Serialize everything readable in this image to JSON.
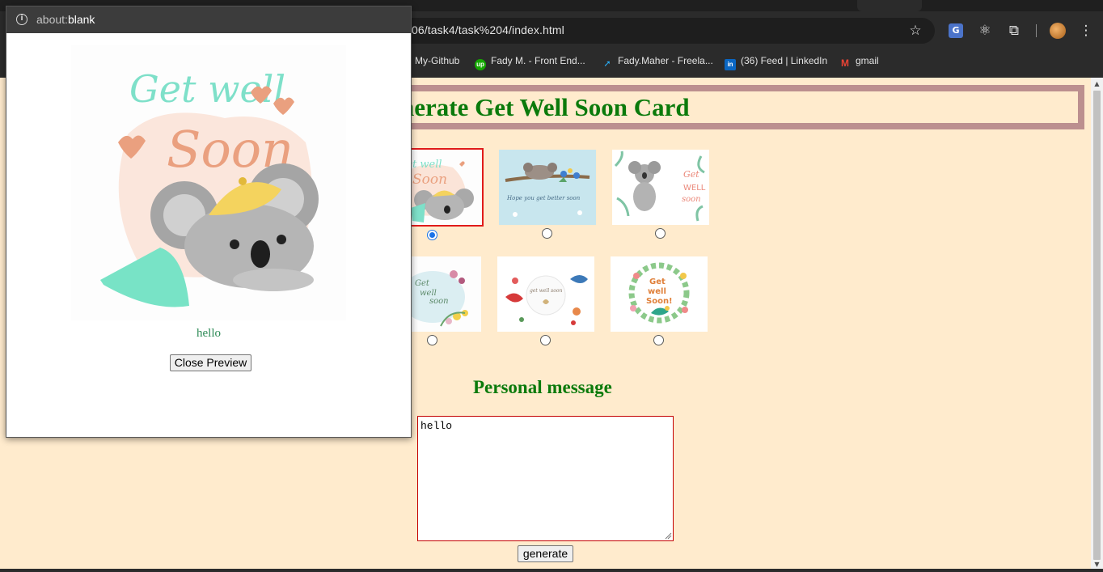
{
  "browser": {
    "url_text": "06/task4/task%204/index.html",
    "bookmarks": [
      {
        "label": "My-Github",
        "icon": "github-icon",
        "color": "#2b2b2b"
      },
      {
        "label": "Fady M. - Front End...",
        "icon": "upwork-icon",
        "color": "#14a800"
      },
      {
        "label": "Fady.Maher - Freela...",
        "icon": "freelancer-icon",
        "color": "#29b2fe"
      },
      {
        "label": "(36) Feed | LinkedIn",
        "icon": "linkedin-icon",
        "color": "#0a66c2"
      },
      {
        "label": "gmail",
        "icon": "gmail-icon",
        "color": "#ea4335"
      }
    ]
  },
  "page": {
    "title": "nerate Get Well Soon Card",
    "background": "#ffebcd",
    "title_color": "#0b7a0b",
    "cards": [
      {
        "name": "get-well-soon-koala-card",
        "selected": true
      },
      {
        "name": "hope-you-get-better-koala-card",
        "selected": false
      },
      {
        "name": "get-well-soon-koala-leaves-card",
        "selected": false
      },
      {
        "name": "get-well-soon-watercolor-flowers-card",
        "selected": false
      },
      {
        "name": "get-well-soon-birds-card",
        "selected": false
      },
      {
        "name": "get-well-soon-bird-wreath-card",
        "selected": false
      }
    ],
    "card_texts": {
      "card1_line1": "Get well",
      "card1_line2": "Soon",
      "card2": "Hope you get better soon",
      "card3_line1": "Get",
      "card3_line2": "WELL",
      "card3_line3": "soon",
      "card4_line1": "Get",
      "card4_line2": "well",
      "card4_line3": "soon",
      "card5": "get well soon",
      "card6_line1": "Get",
      "card6_line2": "well",
      "card6_line3": "Soon!"
    },
    "personal_message_heading": "Personal message",
    "message_value": "hello",
    "generate_label": "generate"
  },
  "popup": {
    "url_prefix": "about:",
    "url_main": "blank",
    "card_line1": "Get well",
    "card_line2": "Soon",
    "message": "hello",
    "close_label": "Close Preview"
  }
}
